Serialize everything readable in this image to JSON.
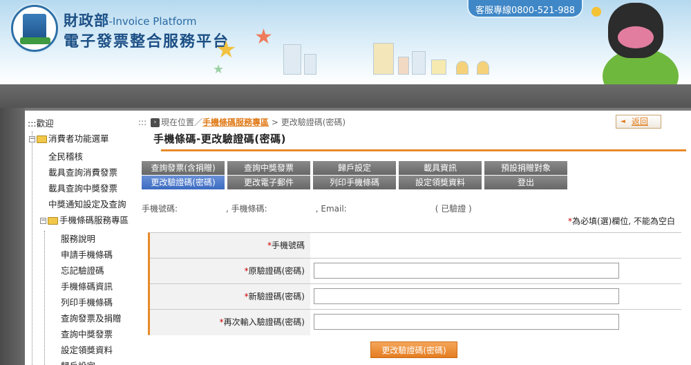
{
  "header": {
    "mof_name": "財政部",
    "mof_en": "E-Invoice Platform",
    "platform_name": "電子發票整合服務平台",
    "hotline": "客服專線0800-521-988"
  },
  "sidebar": {
    "welcome": "歡迎",
    "welcome_prefix": ":::",
    "consumer_menu": "消費者功能選單",
    "items": [
      "全民稽核",
      "載具查詢消費發票",
      "載具查詢中獎發票",
      "中獎通知設定及查詢"
    ],
    "barcode_zone": "手機條碼服務專區",
    "sub_items": [
      "服務說明",
      "申請手機條碼",
      "忘記驗證碼",
      "手機條碼資訊",
      "列印手機條碼",
      "查詢發票及捐贈",
      "查詢中獎發票",
      "設定領獎資料",
      "歸戶設定"
    ]
  },
  "breadcrumb": {
    "prefix": ":::",
    "current_label": "現在位置",
    "separator": "／",
    "link": "手機條碼服務專區",
    "arrow": ">",
    "page": "更改驗證碼(密碼)"
  },
  "back_label": "返回",
  "page_title": "手機條碼-更改驗證碼(密碼)",
  "tabs_row1": [
    "查詢發票(含捐贈)",
    "查詢中獎發票",
    "歸戶設定",
    "載具資訊",
    "預設捐贈對象"
  ],
  "tabs_row2": [
    "更改驗證碼(密碼)",
    "更改電子郵件",
    "列印手機條碼",
    "設定領獎資料",
    "登出"
  ],
  "info": {
    "phone_label": "手機號碼:",
    "barcode_label": ", 手機條碼:",
    "email_label": ", Email:",
    "verified": "( 已驗證 )"
  },
  "required_note": {
    "star": "*",
    "text": "為必填(選)欄位, 不能為空白"
  },
  "form": {
    "rows": [
      {
        "star": "*",
        "label": "手機號碼",
        "value": ""
      },
      {
        "star": "*",
        "label": "原驗證碼(密碼)",
        "value": ""
      },
      {
        "star": "*",
        "label": "新驗證碼(密碼)",
        "value": ""
      },
      {
        "star": "*",
        "label": "再次輸入驗證碼(密碼)",
        "value": ""
      }
    ]
  },
  "submit_label": "更改驗證碼(密碼)",
  "colors": {
    "accent": "#e88a28",
    "active_tab": "#3b6bc1",
    "tab": "#777777",
    "required": "#cc0000"
  }
}
